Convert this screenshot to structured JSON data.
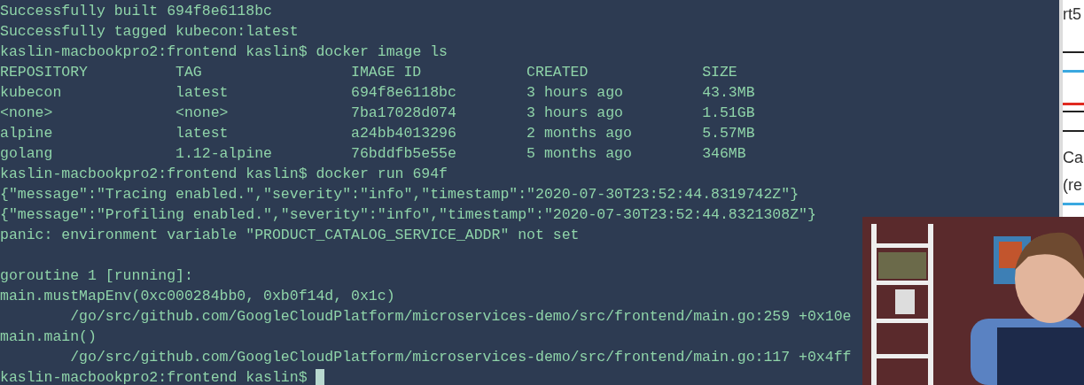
{
  "terminal": {
    "before_table": [
      {
        "text": "Successfully built 694f8e6118bc",
        "indented": false
      },
      {
        "text": "Successfully tagged kubecon:latest",
        "indented": false
      },
      {
        "text": "kaslin-macbookpro2:frontend kaslin$ docker image ls",
        "indented": false
      }
    ],
    "table": {
      "columns": [
        "REPOSITORY",
        "TAG",
        "IMAGE ID",
        "CREATED",
        "SIZE"
      ],
      "rows": [
        [
          "kubecon",
          "latest",
          "694f8e6118bc",
          "3 hours ago",
          "43.3MB"
        ],
        [
          "<none>",
          "<none>",
          "7ba17028d074",
          "3 hours ago",
          "1.51GB"
        ],
        [
          "alpine",
          "latest",
          "a24bb4013296",
          "2 months ago",
          "5.57MB"
        ],
        [
          "golang",
          "1.12-alpine",
          "76bddfb5e55e",
          "5 months ago",
          "346MB"
        ]
      ]
    },
    "after_table": [
      {
        "text": "kaslin-macbookpro2:frontend kaslin$ docker run 694f",
        "indented": false
      },
      {
        "text": "{\"message\":\"Tracing enabled.\",\"severity\":\"info\",\"timestamp\":\"2020-07-30T23:52:44.8319742Z\"}",
        "indented": false
      },
      {
        "text": "{\"message\":\"Profiling enabled.\",\"severity\":\"info\",\"timestamp\":\"2020-07-30T23:52:44.8321308Z\"}",
        "indented": false
      },
      {
        "text": "panic: environment variable \"PRODUCT_CATALOG_SERVICE_ADDR\" not set",
        "indented": false
      },
      {
        "text": "goroutine 1 [running]:",
        "indented": false,
        "blank_line_before": true
      },
      {
        "text": "main.mustMapEnv(0xc000284bb0, 0xb0f14d, 0x1c)",
        "indented": false
      },
      {
        "text": "/go/src/github.com/GoogleCloudPlatform/microservices-demo/src/frontend/main.go:259 +0x10e",
        "indented": true
      },
      {
        "text": "main.main()",
        "indented": false
      },
      {
        "text": "/go/src/github.com/GoogleCloudPlatform/microservices-demo/src/frontend/main.go:117 +0x4ff",
        "indented": true
      }
    ],
    "prompt": "kaslin-macbookpro2:frontend kaslin$"
  },
  "side_window": {
    "texts": [
      "rt5",
      "Ca",
      "(re"
    ]
  }
}
